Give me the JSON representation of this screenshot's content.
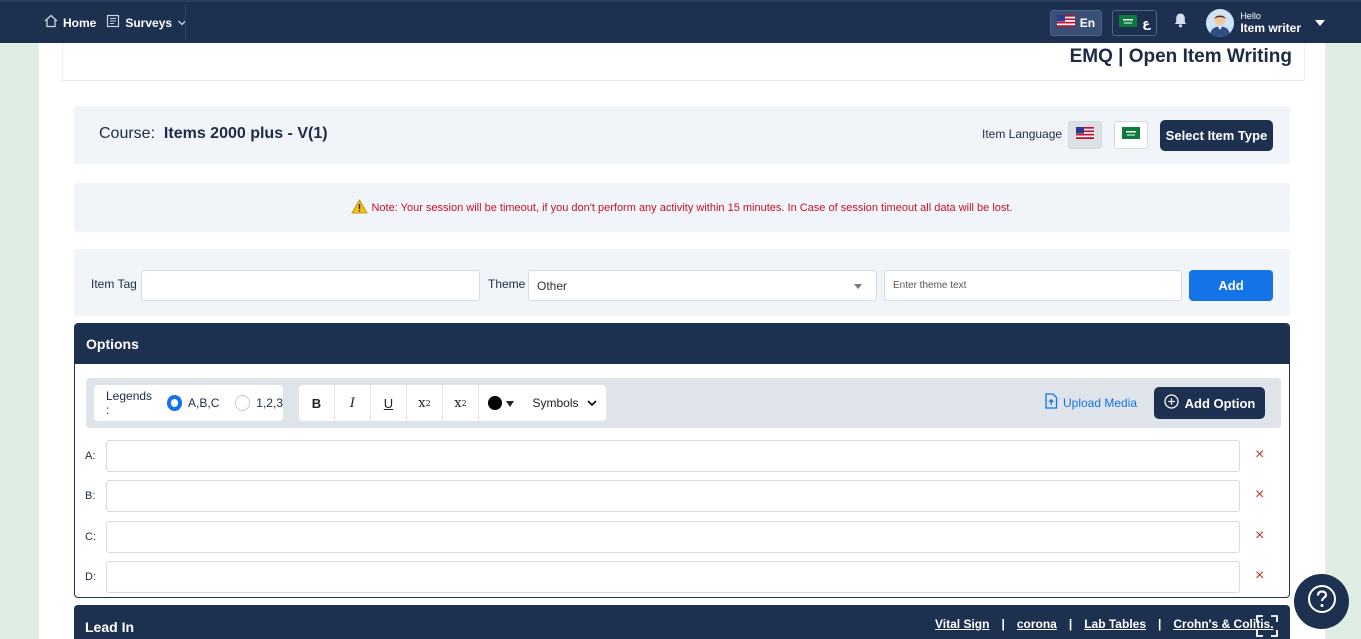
{
  "nav": {
    "home_label": "Home",
    "surveys_label": "Surveys",
    "lang_en_label": "En",
    "lang_ar_label": "ع",
    "hello_label": "Hello",
    "user_name": "Item writer"
  },
  "page": {
    "title": "EMQ | Open Item Writing"
  },
  "course": {
    "label": "Course:",
    "name": "Items 2000 plus - V(1)",
    "item_language_label": "Item Language",
    "select_type_label": "Select Item Type"
  },
  "note": {
    "text": "Note: Your session will be timeout, if you don't perform any activity within 15 minutes. In Case of session timeout all data will be lost."
  },
  "tag": {
    "item_tag_label": "Item Tag",
    "item_tag_value": "",
    "theme_label": "Theme",
    "theme_value": "Other",
    "theme_text_placeholder": "Enter theme text",
    "add_label": "Add"
  },
  "options": {
    "header": "Options",
    "legends_label": "Legends :",
    "legend_abc": "A,B,C",
    "legend_123": "1,2,3",
    "bold": "B",
    "italic": "I",
    "underline": "U",
    "subscript_base": "x",
    "subscript_mark": "2",
    "superscript_base": "x",
    "superscript_mark": "2",
    "symbols_label": "Symbols",
    "upload_label": "Upload Media",
    "add_option_label": "Add Option",
    "rows": [
      {
        "letter": "A:",
        "value": ""
      },
      {
        "letter": "B:",
        "value": ""
      },
      {
        "letter": "C:",
        "value": ""
      },
      {
        "letter": "D:",
        "value": ""
      }
    ],
    "remove_glyph": "×"
  },
  "leadin": {
    "title": "Lead In",
    "links": [
      "Vital Sign",
      "corona",
      "Lab Tables",
      "Crohn's & Colitis."
    ],
    "separator": "|"
  },
  "colors": {
    "navy": "#1e3050",
    "accent_blue": "#1473e6",
    "warning_red": "#c8102e"
  }
}
